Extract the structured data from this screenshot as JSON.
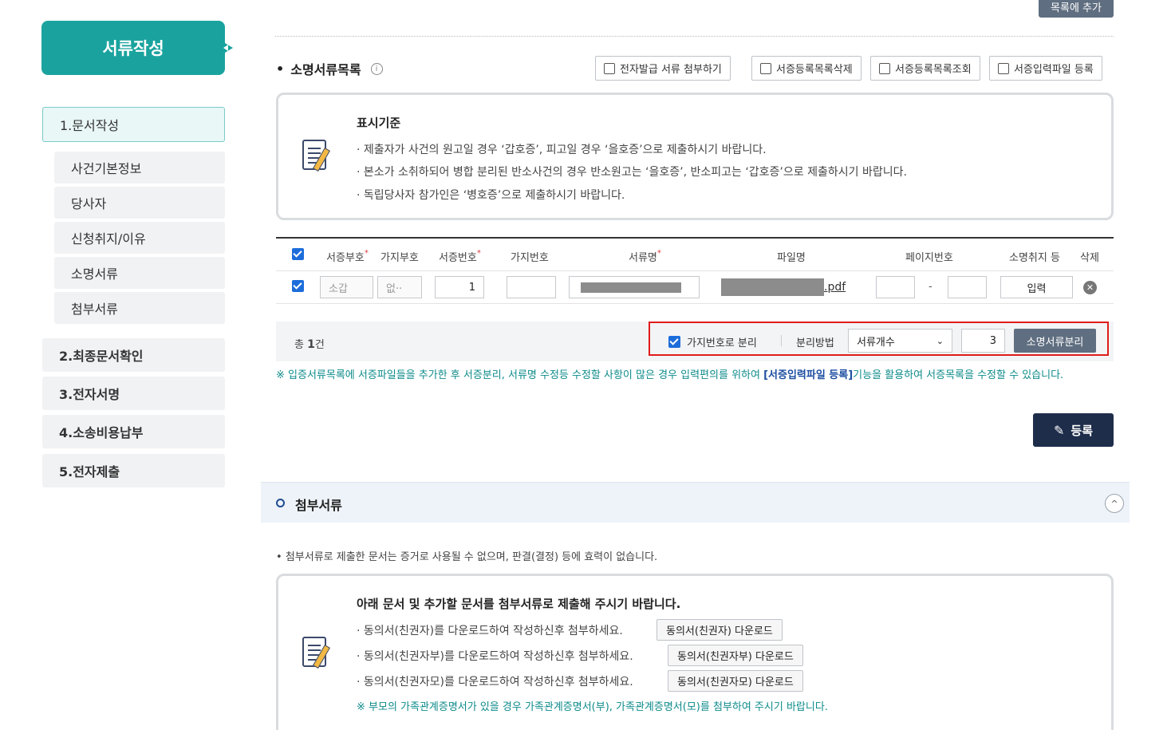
{
  "sidebar": {
    "header": "서류작성",
    "items": [
      {
        "label": "1.문서작성",
        "active": true
      },
      {
        "label": "사건기본정보",
        "sub": true
      },
      {
        "label": "당사자",
        "sub": true
      },
      {
        "label": "신청취지/이유",
        "sub": true
      },
      {
        "label": "소명서류",
        "sub": true
      },
      {
        "label": "첨부서류",
        "sub": true
      },
      {
        "label": "2.최종문서확인"
      },
      {
        "label": "3.전자서명"
      },
      {
        "label": "4.소송비용납부"
      },
      {
        "label": "5.전자제출"
      }
    ]
  },
  "top_button": "목록에 추가",
  "evidence": {
    "title": "소명서류목록",
    "info_icon": "i",
    "toolbar": [
      "전자발급 서류 첨부하기",
      "서증등록목록삭제",
      "서증등록목록조회",
      "서증입력파일 등록"
    ],
    "criteria_title": "표시기준",
    "criteria": [
      "제출자가 사건의 원고일 경우 ‘갑호증’, 피고일 경우 ‘을호증’으로 제출하시기 바랍니다.",
      "본소가 소취하되어 병합 분리된 반소사건의 경우 반소원고는 ‘을호증’, 반소피고는 ‘갑호증’으로 제출하시기 바랍니다.",
      "독립당사자 참가인은 ‘병호증’으로 제출하시기 바랍니다."
    ],
    "columns": [
      "서증부호",
      "가지부호",
      "서증번호",
      "가지번호",
      "서류명",
      "파일명",
      "페이지번호",
      "소명취지 등",
      "삭제"
    ],
    "row": {
      "code_placeholder": "소갑",
      "branch_placeholder": "없··",
      "number": "1",
      "file_ext": ".pdf",
      "page_sep": "-",
      "purpose_btn": "입력"
    },
    "total_prefix": "총",
    "total_count": "1",
    "total_suffix": "건",
    "split_checkbox": "가지번호로 분리",
    "split_method_label": "분리방법",
    "split_method_value": "서류개수",
    "split_count": "3",
    "split_button": "소명서류분리",
    "notice_pre": "※ 입증서류목록에 서증파일들을 추가한 후 서증분리, 서류명 수정등 수정할 사항이 많은 경우 입력편의를 위하여 ",
    "notice_bold": "[서증입력파일 등록]",
    "notice_post": "기능을 활용하여 서증목록을 수정할 수 있습니다.",
    "register_button": "등록"
  },
  "attachments": {
    "title": "첨부서류",
    "toggle_icon": "^",
    "note": "첨부서류로 제출한 문서는 증거로 사용될 수 없으며, 판결(결정) 등에 효력이 없습니다.",
    "box_title": "아래 문서 및 추가할 문서를 첨부서류로 제출해 주시기 바랍니다.",
    "items": [
      {
        "text": "동의서(친권자)를 다운로드하여 작성하신후 첨부하세요.",
        "button": "동의서(친권자) 다운로드"
      },
      {
        "text": "동의서(친권자부)를 다운로드하여 작성하신후 첨부하세요.",
        "button": "동의서(친권자부) 다운로드"
      },
      {
        "text": "동의서(친권자모)를 다운로드하여 작성하신후 첨부하세요.",
        "button": "동의서(친권자모) 다운로드"
      }
    ],
    "footnote": "※ 부모의 가족관계증명서가 있을 경우 가족관계증명서(부), 가족관계증명서(모)를 첨부하여 주시기 바랍니다."
  }
}
